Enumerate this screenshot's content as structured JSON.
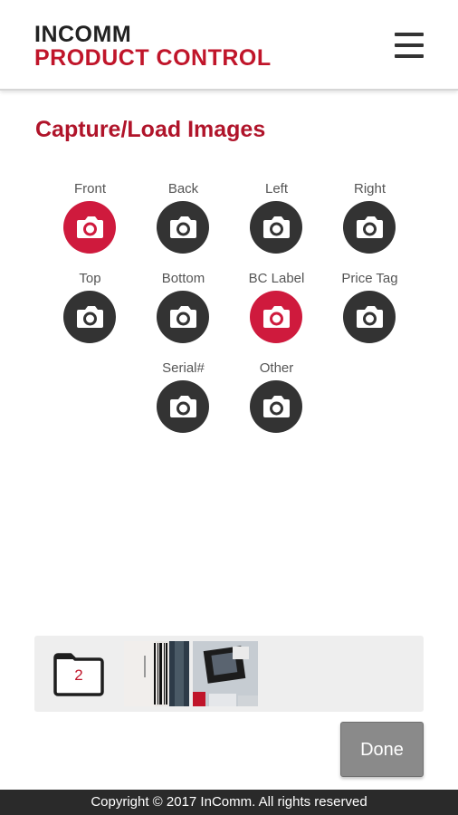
{
  "header": {
    "brand_line1": "INCOMM",
    "brand_line2": "PRODUCT CONTROL",
    "menu_icon": "hamburger-menu-icon"
  },
  "page_title": "Capture/Load Images",
  "colors": {
    "brand_red": "#c0152a",
    "camera_active": "#cf1a3d",
    "camera_inactive": "#333333",
    "done_button": "#8a8a8a",
    "footer_bg": "#2a2a2a"
  },
  "capture_buttons": [
    {
      "label": "Front",
      "active": true,
      "icon": "camera-icon"
    },
    {
      "label": "Back",
      "active": false,
      "icon": "camera-icon"
    },
    {
      "label": "Left",
      "active": false,
      "icon": "camera-icon"
    },
    {
      "label": "Right",
      "active": false,
      "icon": "camera-icon"
    },
    {
      "label": "Top",
      "active": false,
      "icon": "camera-icon"
    },
    {
      "label": "Bottom",
      "active": false,
      "icon": "camera-icon"
    },
    {
      "label": "BC Label",
      "active": true,
      "icon": "camera-icon"
    },
    {
      "label": "Price Tag",
      "active": false,
      "icon": "camera-icon"
    },
    {
      "label": "Serial#",
      "active": false,
      "icon": "camera-icon"
    },
    {
      "label": "Other",
      "active": false,
      "icon": "camera-icon"
    }
  ],
  "image_tray": {
    "folder_icon": "folder-icon",
    "folder_count": "2",
    "thumbnails": [
      {
        "name": "barcode-label-photo"
      },
      {
        "name": "product-front-photo"
      }
    ]
  },
  "done_label": "Done",
  "footer": {
    "copyright": "Copyright © 2017 InComm. All rights reserved"
  }
}
